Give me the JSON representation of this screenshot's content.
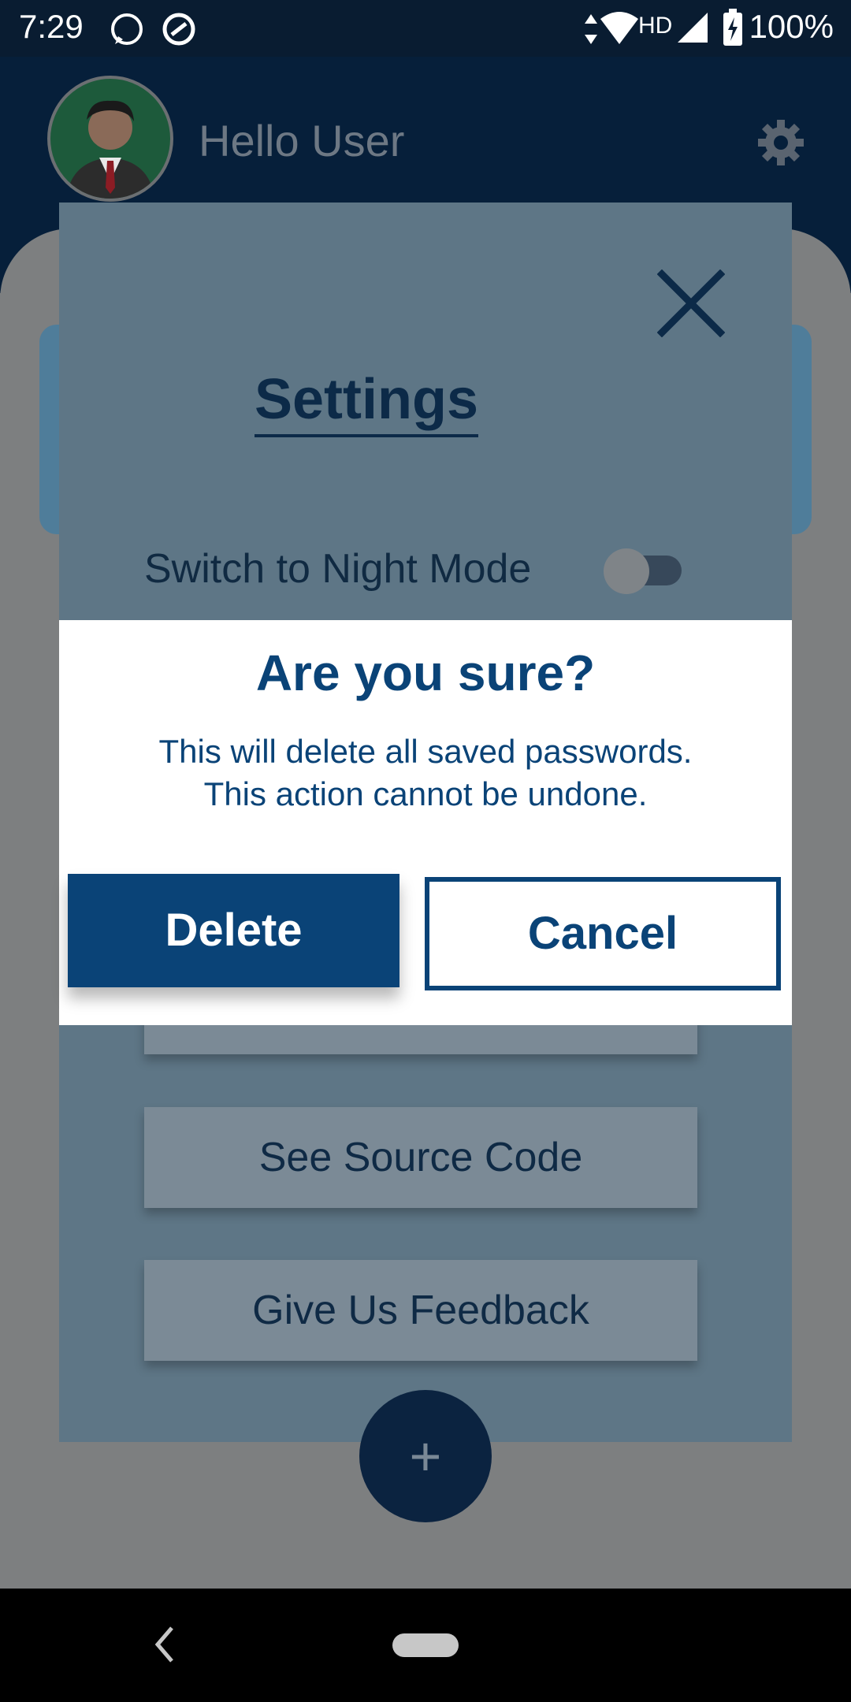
{
  "status_bar": {
    "time": "7:29",
    "network": "HD",
    "battery": "100%"
  },
  "header": {
    "greeting": "Hello User"
  },
  "settings": {
    "title": "Settings",
    "night_mode_label": "Switch to Night Mode",
    "night_mode_on": false,
    "buttons": [
      "See Source Code",
      "Give Us Feedback"
    ]
  },
  "fab": {
    "label": "+"
  },
  "dialog": {
    "title": "Are you sure?",
    "message_line1": "This will delete all saved passwords.",
    "message_line2": "This action cannot be undone.",
    "delete_label": "Delete",
    "cancel_label": "Cancel"
  },
  "colors": {
    "primary": "#0a4377",
    "header": "#061f3a",
    "scrim": "#7d7f80"
  }
}
